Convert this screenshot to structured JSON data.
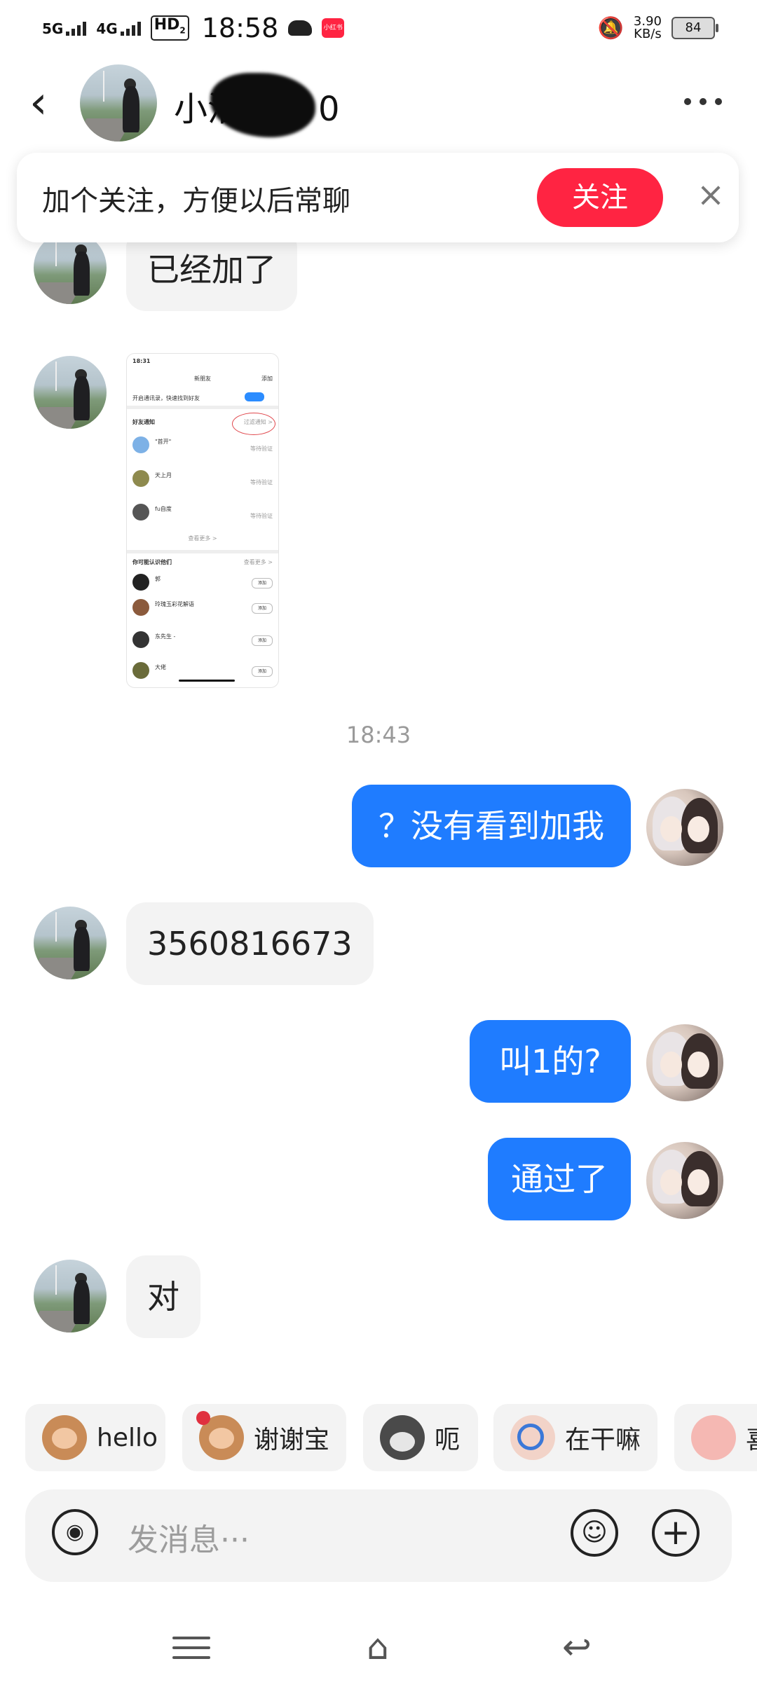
{
  "status_bar": {
    "net1": "5G",
    "net2": "4G",
    "hd": "HD",
    "hd_sub": "2",
    "time": "18:58",
    "app_badge": "小红书",
    "speed_value": "3.90",
    "speed_unit": "KB/s",
    "battery": "84"
  },
  "header": {
    "back_icon": "‹",
    "contact_name": "小洛",
    "contact_name_suffix": "0"
  },
  "follow_banner": {
    "text": "加个关注，方便以后常聊",
    "button": "关注",
    "close_icon": "×"
  },
  "messages": {
    "m1": "已经加了",
    "timestamp": "18:43",
    "m2": "？没有看到加我",
    "m3": "3560816673",
    "m4": "叫1的?",
    "m5": "通过了",
    "m6": "对"
  },
  "screenshot_thumb": {
    "time": "18:31",
    "title": "新朋友",
    "add": "添加",
    "contacts_tip": "开启通讯录，快速找到好友",
    "friend_notice": "好友通知",
    "filter": "过滤通知 >",
    "f1": "\"首开\"",
    "f2": "天上月",
    "f3": "fu自度",
    "waiting": "等待验证",
    "see_more": "查看更多 >",
    "maybe_know": "你可能认识他们",
    "see_more2": "查看更多 >",
    "s1": "郭",
    "s2": "玲瑰玉彩花解语",
    "s3": "东先生 -",
    "s4": "大佬",
    "add_btn": "添加"
  },
  "quick_replies": {
    "r1": "hello",
    "r2": "谢谢宝",
    "r3": "呃",
    "r4": "在干嘛",
    "r5": "喜"
  },
  "input": {
    "placeholder": "发消息···",
    "emoji_icon": "☺",
    "plus_icon": "+"
  }
}
